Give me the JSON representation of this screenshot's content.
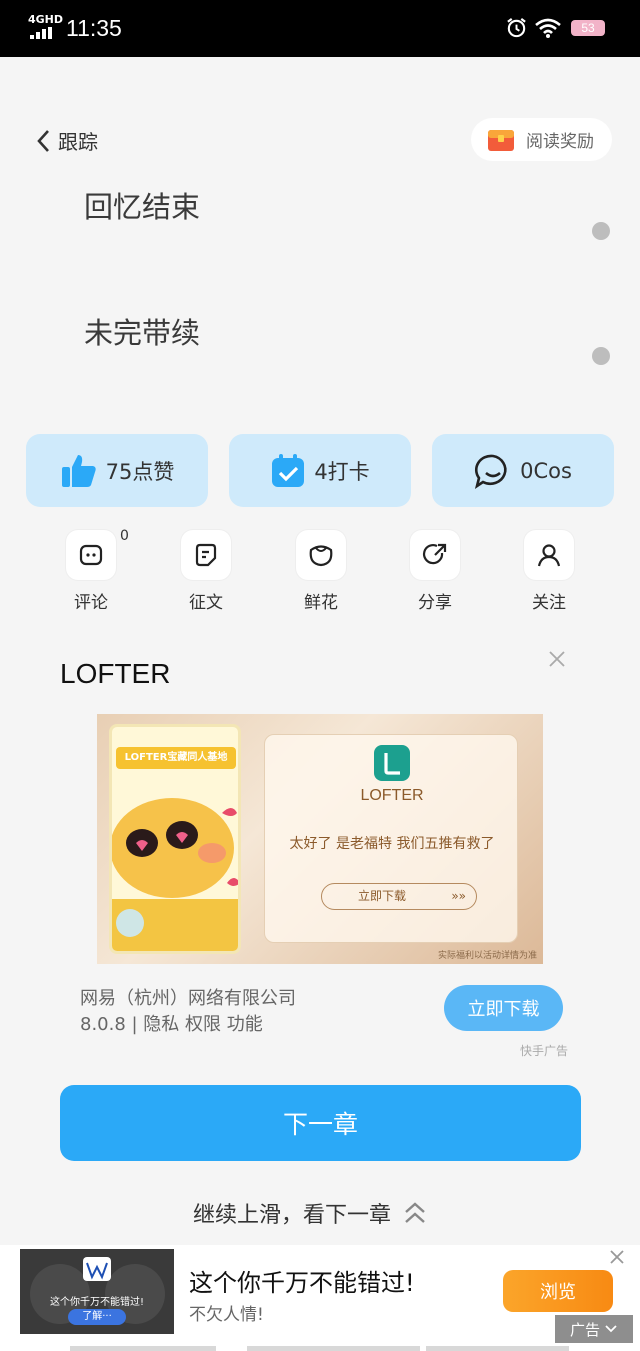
{
  "status_bar": {
    "network": "4GHD",
    "time": "11:35",
    "battery": "53"
  },
  "header": {
    "back_label": "跟踪",
    "reward_label": "阅读奖励"
  },
  "content": {
    "paragraphs": [
      "回忆结束",
      "未完带续"
    ]
  },
  "stats": [
    {
      "label": "75点赞",
      "icon": "thumbs-up-icon"
    },
    {
      "label": "4打卡",
      "icon": "calendar-check-icon"
    },
    {
      "label": "0Cos",
      "icon": "chat-bubble-icon"
    }
  ],
  "actions": [
    {
      "label": "评论",
      "icon": "comment-icon"
    },
    {
      "label": "征文",
      "icon": "essay-icon"
    },
    {
      "label": "鲜花",
      "icon": "flower-icon"
    },
    {
      "label": "分享",
      "icon": "share-icon"
    },
    {
      "label": "关注",
      "icon": "user-follow-icon"
    }
  ],
  "comment_count": "0",
  "ad": {
    "title": "LOFTER",
    "poster_heading": "LOFTER宝藏同人基地",
    "card_brand": "LOFTER",
    "card_text": "太好了 是老福特 我们五推有救了",
    "card_button": "立即下载",
    "card_arrows": "»»",
    "note": "实际福利以活动详情为准",
    "company": "网易（杭州）网络有限公司",
    "meta": "8.0.8 | 隐私  权限  功能",
    "download_label": "立即下载",
    "source": "快手广告"
  },
  "next_chapter_label": "下一章",
  "swipe_hint": "继续上滑，看下一章",
  "bottom_ad": {
    "thumb_text": "这个你千万不能错过!",
    "thumb_button": "了解···",
    "title": "这个你千万不能错过!",
    "subtitle": "不欠人情!",
    "button_label": "浏览",
    "tag": "广告"
  },
  "colors": {
    "primary": "#2ba9f7",
    "pill_bg": "#cfeafb",
    "accent_orange": "#f88a13"
  }
}
